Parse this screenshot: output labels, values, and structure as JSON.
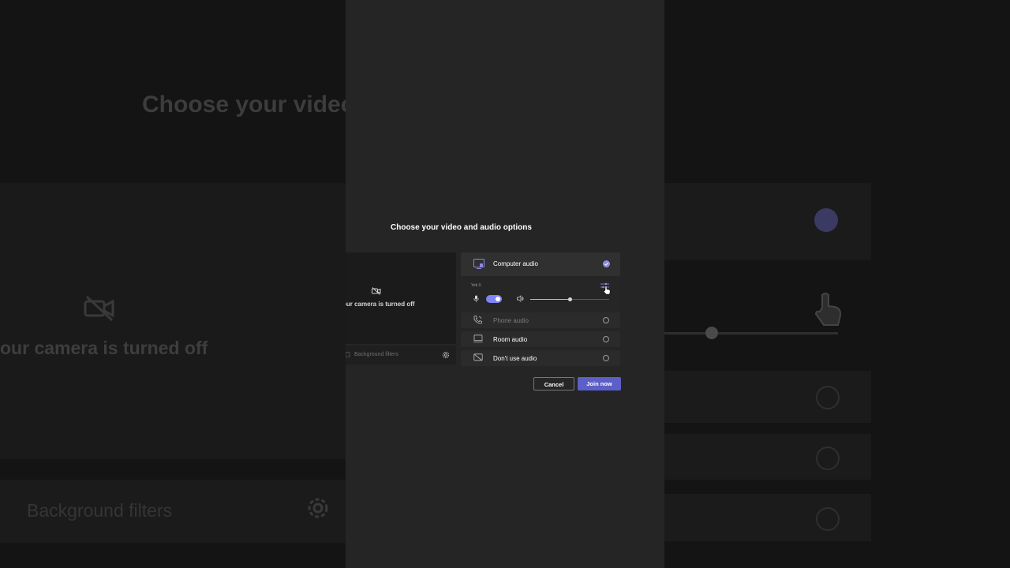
{
  "dialog": {
    "title": "Choose your video and audio options"
  },
  "video": {
    "camera_status": "our camera is turned off",
    "background_filters_label": "Background filters"
  },
  "audio": {
    "options": [
      {
        "label": "Computer audio",
        "selected": true,
        "icon": "monitor-speaker-icon"
      },
      {
        "label": "Phone audio",
        "selected": false,
        "icon": "phone-icon"
      },
      {
        "label": "Room audio",
        "selected": false,
        "icon": "room-device-icon"
      },
      {
        "label": "Don't use audio",
        "selected": false,
        "icon": "no-audio-icon"
      }
    ],
    "device_name": "Yeti X",
    "mic_enabled": true,
    "volume_fraction": 0.5
  },
  "actions": {
    "cancel_label": "Cancel",
    "join_label": "Join now"
  },
  "background_copy": {
    "title": "Choose your video",
    "camera_status": "our camera is turned off",
    "background_filters_label": "Background filters"
  },
  "colors": {
    "accent": "#5b5fc7",
    "toggle": "#7f85f5",
    "check": "#8b8ae0",
    "surface": "#252525"
  }
}
